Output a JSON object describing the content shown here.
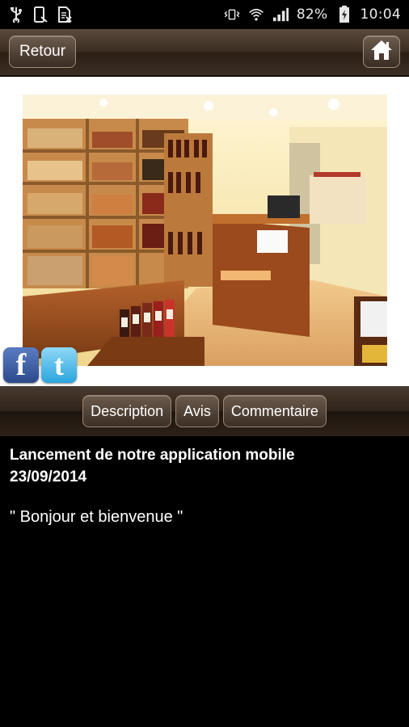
{
  "status_bar": {
    "icons_left": [
      "usb-icon",
      "phone-debug-icon",
      "sim-off-icon"
    ],
    "battery_percent": "82%",
    "time": "10:04",
    "icons_right": [
      "vibrate-icon",
      "wifi-icon",
      "signal-icon",
      "battery-charging-icon"
    ]
  },
  "header": {
    "back_label": "Retour",
    "home_icon": "home-icon"
  },
  "gallery": {
    "social": [
      "facebook-icon",
      "twitter-icon"
    ],
    "facebook_glyph": "f",
    "twitter_glyph": "t"
  },
  "tabs": [
    {
      "label": "Description"
    },
    {
      "label": "Avis"
    },
    {
      "label": "Commentaire"
    }
  ],
  "article": {
    "title": "Lancement de notre application mobile",
    "date": "23/09/2014",
    "message": "\" Bonjour et bienvenue \""
  },
  "colors": {
    "accent_brown": "#3b2d22",
    "background": "#000000",
    "facebook": "#3b5998",
    "twitter": "#2ba5dd"
  }
}
